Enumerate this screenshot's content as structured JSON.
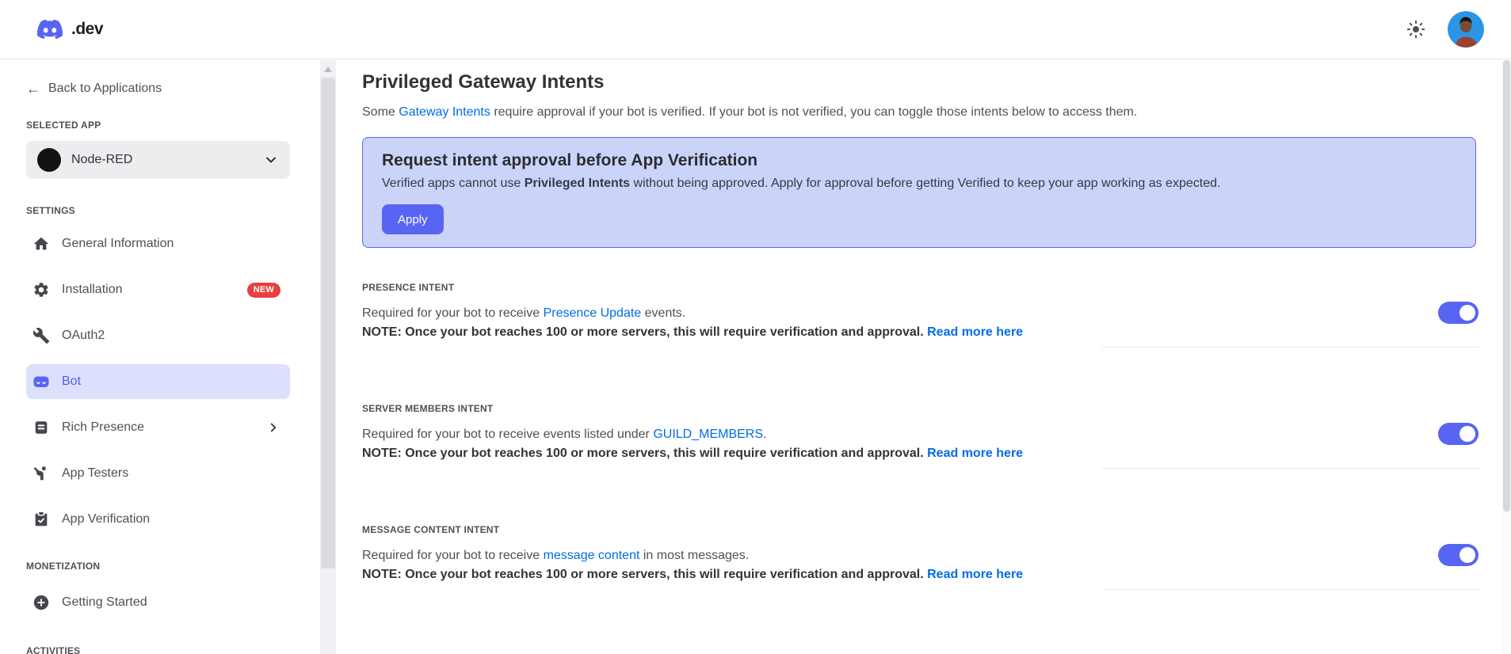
{
  "colors": {
    "accent": "#5865f2",
    "link_blue": "#006ce7",
    "banner_bg": "#ccd3f8",
    "badge_red": "#e8403f",
    "toggle_on": "#5865f2",
    "selected_item_bg": "#dde0fc"
  },
  "header": {
    "logo_text": ".dev",
    "logo_icon": "discord-logo-icon",
    "theme_icon": "sun-icon",
    "avatar_icon": "user-avatar"
  },
  "sidebar": {
    "back_link": "Back to Applications",
    "back_arrow": "←",
    "selected_app_heading": "SELECTED APP",
    "app_selector": {
      "name": "Node-RED",
      "chevron": "chevron-down-icon"
    },
    "settings_heading": "SETTINGS",
    "items": [
      {
        "label": "General Information",
        "icon": "home-icon"
      },
      {
        "label": "Installation",
        "icon": "gear-icon",
        "badge": "NEW"
      },
      {
        "label": "OAuth2",
        "icon": "wrench-icon"
      },
      {
        "label": "Bot",
        "icon": "bot-icon",
        "selected": true
      },
      {
        "label": "Rich Presence",
        "icon": "rich-presence-icon",
        "has_submenu": true
      },
      {
        "label": "App Testers",
        "icon": "app-testers-icon"
      },
      {
        "label": "App Verification",
        "icon": "app-verification-icon"
      }
    ],
    "monetization_heading": "MONETIZATION",
    "monetization_items": [
      {
        "label": "Getting Started",
        "icon": "plus-circle-icon"
      }
    ],
    "activities_heading": "ACTIVITIES"
  },
  "main": {
    "title": "Privileged Gateway Intents",
    "intro": {
      "prefix": "Some ",
      "link": "Gateway Intents",
      "suffix": " require approval if your bot is verified. If your bot is not verified, you can toggle those intents below to access them."
    },
    "banner": {
      "title": "Request intent approval before App Verification",
      "body_prefix": "Verified apps cannot use ",
      "body_bold": "Privileged Intents",
      "body_suffix": " without being approved. Apply for approval before getting Verified to keep your app working as expected.",
      "apply_button": "Apply"
    },
    "intents": [
      {
        "label": "PRESENCE INTENT",
        "desc_prefix": "Required for your bot to receive ",
        "desc_link": "Presence Update",
        "desc_suffix": " events.",
        "note": "NOTE: Once your bot reaches 100 or more servers, this will require verification and approval. ",
        "note_link": "Read more here",
        "enabled": true
      },
      {
        "label": "SERVER MEMBERS INTENT",
        "desc_prefix": "Required for your bot to receive events listed under ",
        "desc_link": "GUILD_MEMBERS",
        "desc_suffix": ".",
        "note": "NOTE: Once your bot reaches 100 or more servers, this will require verification and approval. ",
        "note_link": "Read more here",
        "enabled": true
      },
      {
        "label": "MESSAGE CONTENT INTENT",
        "desc_prefix": "Required for your bot to receive ",
        "desc_link": "message content",
        "desc_suffix": " in most messages.",
        "note": "NOTE: Once your bot reaches 100 or more servers, this will require verification and approval. ",
        "note_link": "Read more here",
        "enabled": true
      }
    ]
  }
}
